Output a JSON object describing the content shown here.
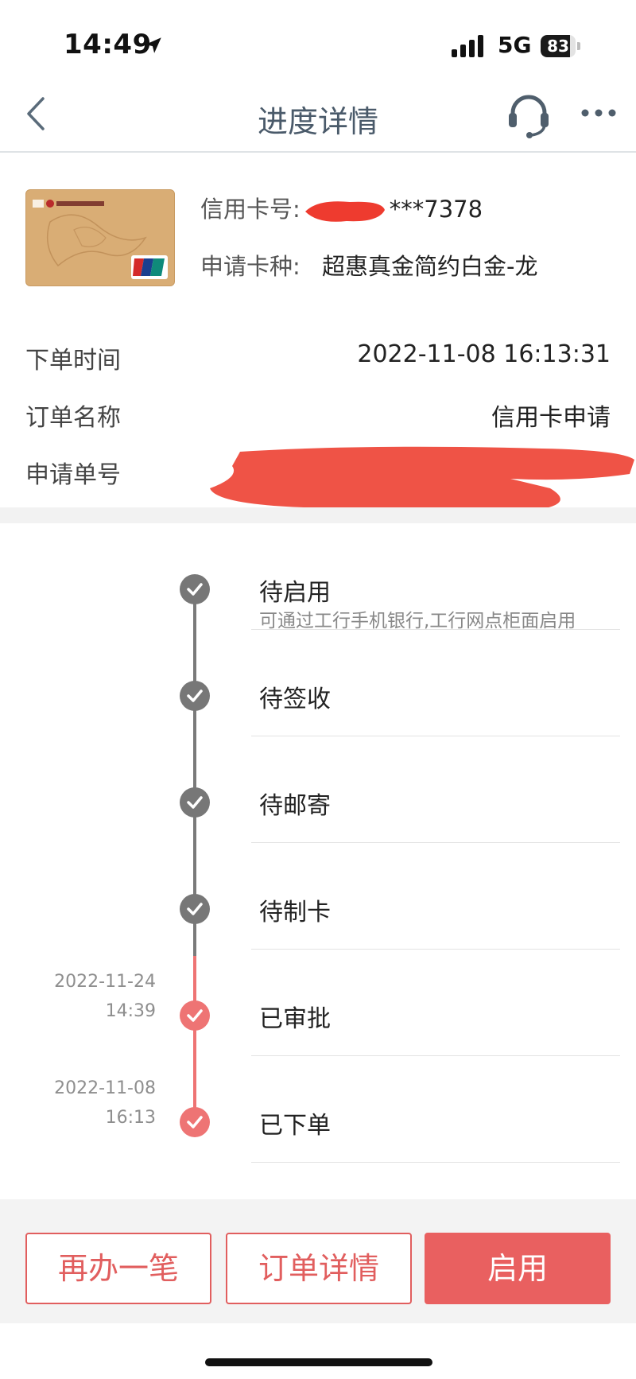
{
  "status_bar": {
    "time": "14:49",
    "network": "5G",
    "battery": "83",
    "battery_level": 0.83
  },
  "nav": {
    "title": "进度详情"
  },
  "card": {
    "number_label": "信用卡号:",
    "number_suffix": "***7378",
    "type_label": "申请卡种:",
    "type_value": "超惠真金简约白金-龙"
  },
  "order": {
    "time_label": "下单时间",
    "time_value": "2022-11-08 16:13:31",
    "name_label": "订单名称",
    "name_value": "信用卡申请",
    "number_label": "申请单号"
  },
  "timeline": [
    {
      "title": "待启用",
      "desc": "可通过工行手机银行,工行网点柜面启用",
      "date": "",
      "time": "",
      "state": "pending"
    },
    {
      "title": "待签收",
      "desc": "",
      "date": "",
      "time": "",
      "state": "pending"
    },
    {
      "title": "待邮寄",
      "desc": "",
      "date": "",
      "time": "",
      "state": "pending"
    },
    {
      "title": "待制卡",
      "desc": "",
      "date": "",
      "time": "",
      "state": "pending"
    },
    {
      "title": "已审批",
      "desc": "",
      "date": "2022-11-24",
      "time": "14:39",
      "state": "done"
    },
    {
      "title": "已下单",
      "desc": "",
      "date": "2022-11-08",
      "time": "16:13",
      "state": "done"
    }
  ],
  "actions": {
    "again_label": "再办一笔",
    "detail_label": "订单详情",
    "activate_label": "启用"
  },
  "colors": {
    "accent": "#e96060",
    "pending": "#777777",
    "done": "#ee7474"
  },
  "icons": [
    "location-arrow-icon",
    "signal-icon",
    "battery-icon",
    "back-icon",
    "headset-icon",
    "more-icon",
    "check-icon"
  ]
}
